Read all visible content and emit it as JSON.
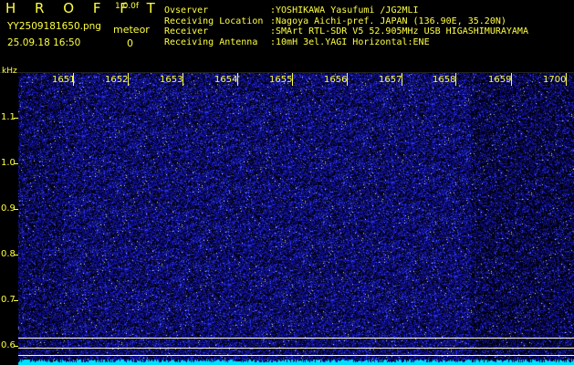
{
  "header": {
    "app_title": "H R O F F T",
    "app_version": "1.0.0f",
    "file_name": "YY2509181650.png",
    "datetime": "25.09.18 16:50",
    "meteor_label": "meteor",
    "meteor_count": "0"
  },
  "info": [
    {
      "label": "Ovserver",
      "value": ":YOSHIKAWA Yasufumi /JG2MLI"
    },
    {
      "label": "Receiving Location",
      "value": ":Nagoya Aichi-pref. JAPAN (136.90E, 35.20N)"
    },
    {
      "label": "Receiver",
      "value": ":SMArt RTL-SDR V5 52.905MHz USB HIGASHIMURAYAMA"
    },
    {
      "label": "Receiving Antenna",
      "value": ":10mH 3el.YAGI Horizontal:ENE"
    }
  ],
  "axis": {
    "y_unit": "kHz",
    "time_labels": [
      "1651",
      "1652",
      "1653",
      "1654",
      "1655",
      "1656",
      "1657",
      "1658",
      "1659",
      "1700"
    ],
    "freq_labels": [
      "1.1",
      "1.0",
      "0.9",
      "0.8",
      "0.7",
      "0.6"
    ]
  },
  "colors": {
    "background": "#000000",
    "noise": "#1e1ec8",
    "baseline": "#00e0ff",
    "text": "#ffff40"
  }
}
